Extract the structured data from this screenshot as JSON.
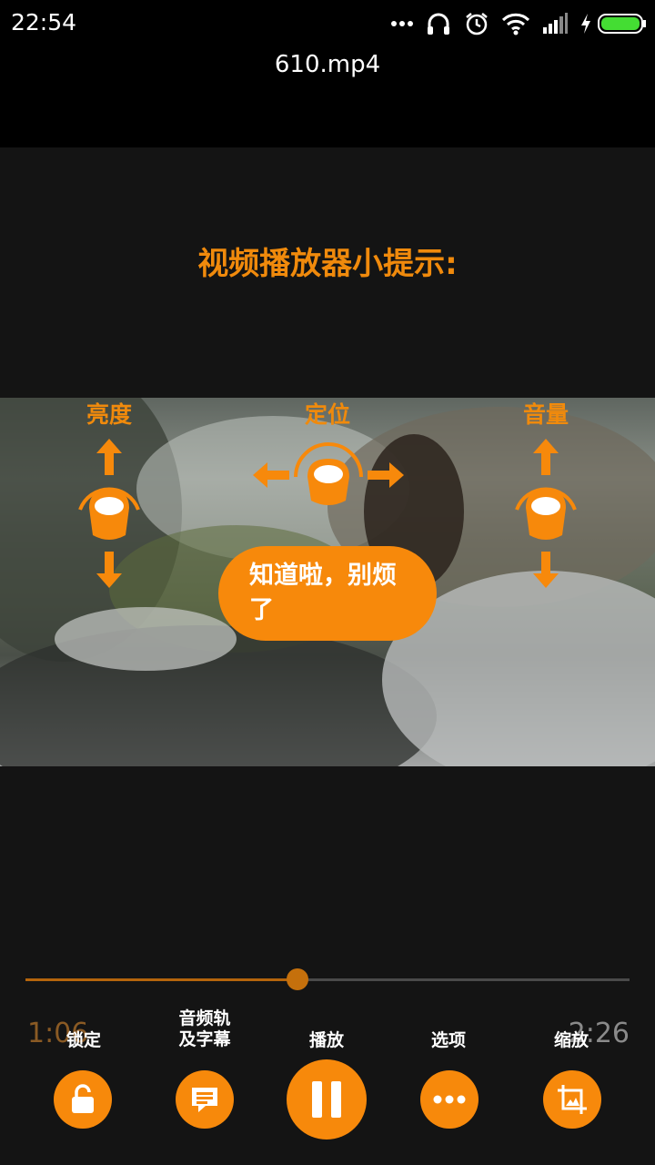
{
  "status_bar": {
    "time": "22:54",
    "icons": [
      "more-dots-icon",
      "headphones-icon",
      "alarm-icon",
      "wifi-icon",
      "signal-icon",
      "charging-icon",
      "battery-icon"
    ]
  },
  "title_bar": {
    "title": "610.mp4"
  },
  "tips": {
    "title": "视频播放器小提示:",
    "brightness_label": "亮度",
    "seek_label": "定位",
    "volume_label": "音量",
    "dismiss_label": "知道啦，别烦了"
  },
  "playback": {
    "elapsed": "1:06",
    "total": "2:26",
    "progress": 0.45
  },
  "controls": {
    "lock_label": "锁定",
    "audio_subtitle_label_line1": "音频轨",
    "audio_subtitle_label_line2": "及字幕",
    "play_label": "播放",
    "options_label": "选项",
    "zoom_label": "缩放"
  },
  "colors": {
    "accent": "#f7890b",
    "background": "#141414"
  }
}
